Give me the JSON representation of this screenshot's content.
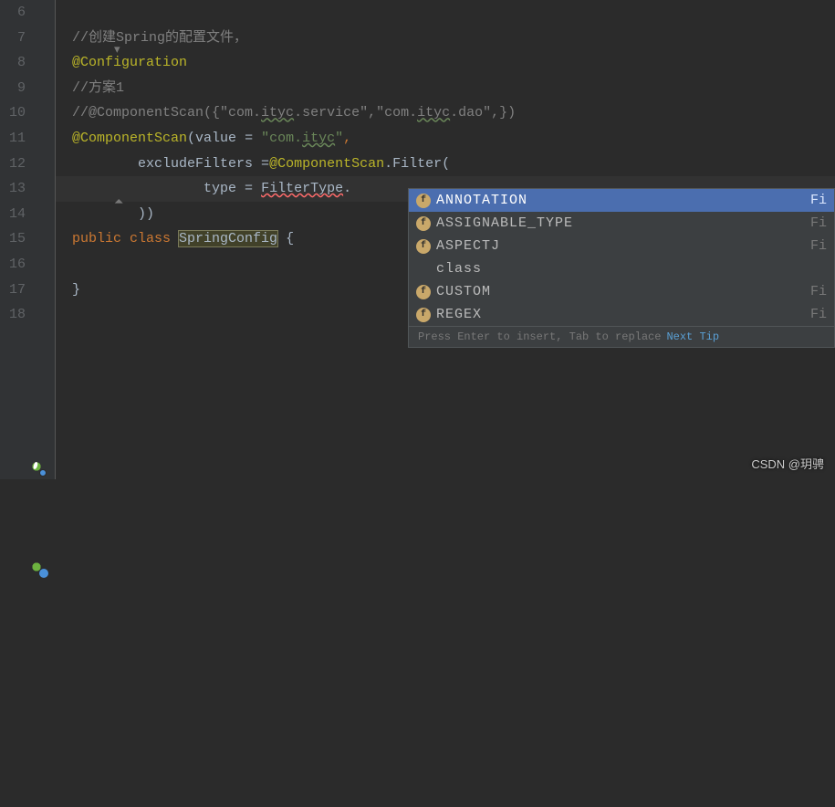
{
  "lineNumbers": [
    "6",
    "7",
    "8",
    "9",
    "10",
    "11",
    "12",
    "13",
    "14",
    "15",
    "16",
    "17",
    "18"
  ],
  "code": {
    "line6": "",
    "line7_comment": "//创建Spring的配置文件，",
    "line8_annotation": "@Configuration",
    "line9_comment": "//方案1",
    "line10_comment_pre": "//@ComponentScan({\"com.",
    "line10_squiggly1": "ityc",
    "line10_mid": ".service\",\"com.",
    "line10_squiggly2": "ityc",
    "line10_end": ".dao\",})",
    "line11_ann": "@ComponentScan",
    "line11_paren": "(",
    "line11_param": "value ",
    "line11_eq": "= ",
    "line11_str_pre": "\"com.",
    "line11_str_sq": "ityc",
    "line11_str_post": "\"",
    "line11_comma": ",",
    "line12_indent": "        ",
    "line12_param": "excludeFilters ",
    "line12_eq": "=",
    "line12_ann": "@ComponentScan",
    "line12_dot": ".",
    "line12_filter": "Filter",
    "line12_paren": "(",
    "line13_indent": "                ",
    "line13_param": "type ",
    "line13_eq": "= ",
    "line13_type": "FilterType",
    "line13_dot": ".",
    "line14_indent": "        ",
    "line14_close": "))",
    "line15_public": "public ",
    "line15_class": "class ",
    "line15_name": "SpringConfig",
    "line15_brace": " {",
    "line16": "",
    "line17_close": "}",
    "line18": ""
  },
  "autocomplete": {
    "items": [
      {
        "label": "ANNOTATION",
        "type": "Fi",
        "icon": "f",
        "selected": true
      },
      {
        "label": "ASSIGNABLE_TYPE",
        "type": "Fi",
        "icon": "f",
        "selected": false
      },
      {
        "label": "ASPECTJ",
        "type": "Fi",
        "icon": "f",
        "selected": false
      },
      {
        "label": "class",
        "type": "",
        "icon": "",
        "selected": false
      },
      {
        "label": "CUSTOM",
        "type": "Fi",
        "icon": "f",
        "selected": false
      },
      {
        "label": "REGEX",
        "type": "Fi",
        "icon": "f",
        "selected": false
      }
    ],
    "hint": "Press Enter to insert, Tab to replace",
    "tipLink": "Next Tip"
  },
  "watermark": "CSDN @玥骋"
}
